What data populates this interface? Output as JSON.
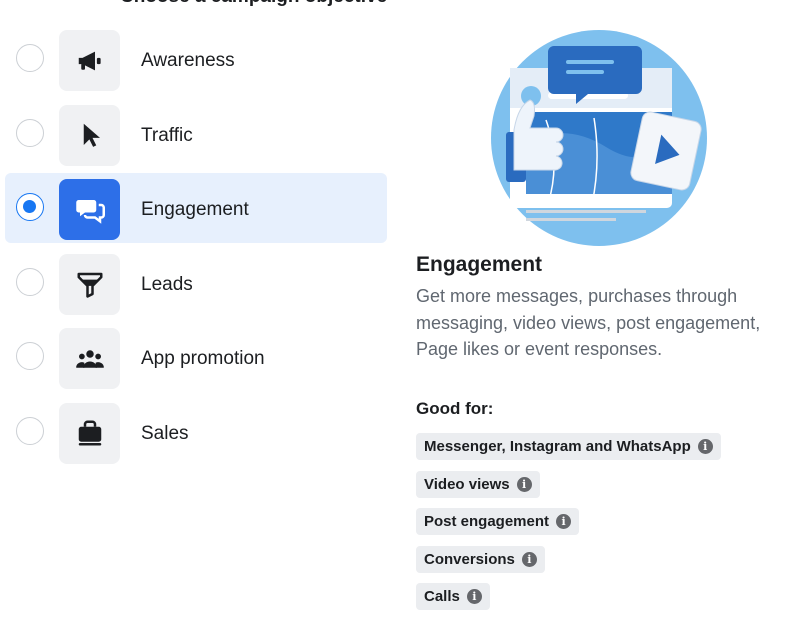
{
  "heading_cutoff": "Choose a campaign objective",
  "objectives": [
    {
      "label": "Awareness",
      "icon": "megaphone-icon",
      "selected": false
    },
    {
      "label": "Traffic",
      "icon": "cursor-icon",
      "selected": false
    },
    {
      "label": "Engagement",
      "icon": "chat-bubbles-icon",
      "selected": true
    },
    {
      "label": "Leads",
      "icon": "filter-icon",
      "selected": false
    },
    {
      "label": "App promotion",
      "icon": "people-icon",
      "selected": false
    },
    {
      "label": "Sales",
      "icon": "shopping-bag-icon",
      "selected": false
    }
  ],
  "details": {
    "title": "Engagement",
    "description": "Get more messages, purchases through messaging, video views, post engagement, Page likes or event responses.",
    "good_for_label": "Good for:",
    "tags": [
      {
        "label": "Messenger, Instagram and WhatsApp",
        "info_icon": "info-icon"
      },
      {
        "label": "Video views",
        "info_icon": "info-icon"
      },
      {
        "label": "Post engagement",
        "info_icon": "info-icon"
      },
      {
        "label": "Conversions",
        "info_icon": "info-icon"
      },
      {
        "label": "Calls",
        "info_icon": "info-icon"
      }
    ]
  },
  "colors": {
    "accent": "#1877f2",
    "selected_bg": "#e7f0fd",
    "tile_bg": "#f0f1f3",
    "tag_bg": "#ebedf0",
    "muted_text": "#606770"
  }
}
